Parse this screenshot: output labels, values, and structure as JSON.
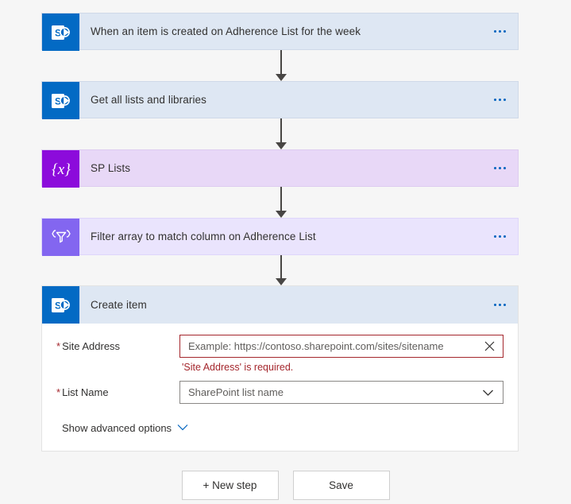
{
  "colors": {
    "page_bg": "#f6f6f6",
    "sharepoint_blue": "#036ac4",
    "card_blue": "#dee7f3",
    "variable_purple": "#8c0bdb",
    "card_purple": "#e8d8f7",
    "filter_purple": "#8366f0",
    "card_lavender": "#eae4fd",
    "error_red": "#a4262c",
    "link_blue": "#0064bf"
  },
  "flow": {
    "steps": [
      {
        "title": "When an item is created on Adherence List for the week",
        "icon": "sharepoint-icon",
        "style": "blue",
        "menu": "more-options"
      },
      {
        "title": "Get all lists and libraries",
        "icon": "sharepoint-icon",
        "style": "blue",
        "menu": "more-options"
      },
      {
        "title": "SP Lists",
        "icon": "variable-icon",
        "style": "purple",
        "menu": "more-options"
      },
      {
        "title": "Filter array to match column on Adherence List",
        "icon": "filter-array-icon",
        "style": "lavender",
        "menu": "more-options"
      }
    ]
  },
  "action_card": {
    "title": "Create item",
    "icon": "sharepoint-icon",
    "menu": "more-options",
    "fields": [
      {
        "label": "Site Address",
        "required": true,
        "required_marker": "*",
        "placeholder": "Example: https://contoso.sharepoint.com/sites/sitename",
        "value": "",
        "error": "'Site Address' is required.",
        "clear_icon": "close-icon"
      },
      {
        "label": "List Name",
        "required": true,
        "required_marker": "*",
        "placeholder": "SharePoint list name",
        "value": "",
        "dropdown_icon": "chevron-down-icon"
      }
    ],
    "advanced_options": {
      "label": "Show advanced options",
      "icon": "chevron-down-icon"
    }
  },
  "footer": {
    "new_step_label": "+ New step",
    "save_label": "Save"
  }
}
